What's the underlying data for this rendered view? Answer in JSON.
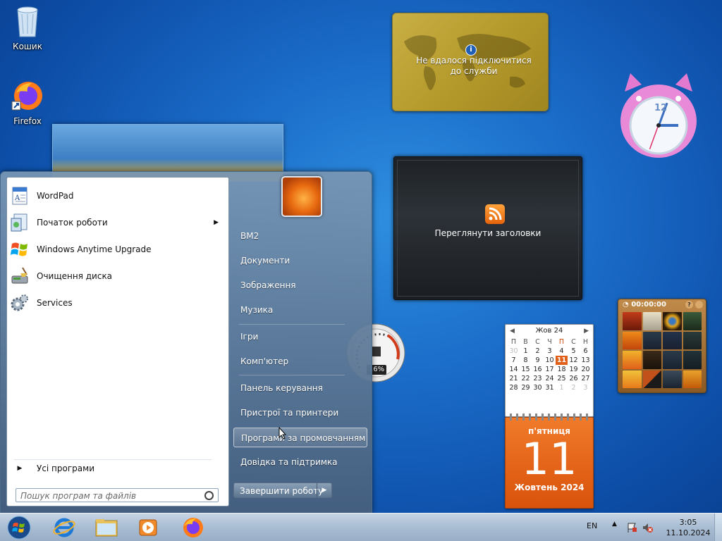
{
  "desktop": {
    "icons": [
      {
        "label": "Кошик",
        "icon": "recycle-bin-icon"
      },
      {
        "label": "Firefox",
        "icon": "firefox-icon"
      }
    ]
  },
  "gadgets": {
    "currency": {
      "message": "Не вдалося підключитися до служби"
    },
    "feeds": {
      "label": "Переглянути заголовки"
    },
    "cpu": {
      "value": "16%"
    },
    "clock": {
      "hour_numeral": "12"
    },
    "calendar": {
      "month_label": "Жов 24",
      "weekdays": [
        "П",
        "В",
        "С",
        "Ч",
        "П",
        "С",
        "Н"
      ],
      "weeks": [
        [
          "30",
          "1",
          "2",
          "3",
          "4",
          "5",
          "6"
        ],
        [
          "7",
          "8",
          "9",
          "10",
          "11",
          "12",
          "13"
        ],
        [
          "14",
          "15",
          "16",
          "17",
          "18",
          "19",
          "20"
        ],
        [
          "21",
          "22",
          "23",
          "24",
          "25",
          "26",
          "27"
        ],
        [
          "28",
          "29",
          "30",
          "31",
          "1",
          "2",
          "3"
        ]
      ],
      "today": "11",
      "weekday_full": "п'ятниця",
      "day_big": "11",
      "month_year": "Жовтень 2024"
    },
    "puzzle": {
      "timer": "00:00:00"
    }
  },
  "start_menu": {
    "programs": [
      {
        "label": "WordPad",
        "icon": "wordpad-icon",
        "submenu": false
      },
      {
        "label": "Початок роботи",
        "icon": "getting-started-icon",
        "submenu": true
      },
      {
        "label": "Windows Anytime Upgrade",
        "icon": "windows-flag-icon",
        "submenu": false
      },
      {
        "label": "Очищення диска",
        "icon": "disk-cleanup-icon",
        "submenu": false
      },
      {
        "label": "Services",
        "icon": "services-gear-icon",
        "submenu": false
      }
    ],
    "all_programs": "Усі програми",
    "search_placeholder": "Пошук програм та файлів",
    "right_items": [
      "ВМ2",
      "Документи",
      "Зображення",
      "Музика",
      "Ігри",
      "Комп'ютер",
      "Панель керування",
      "Пристрої та принтери",
      "Програми за промовчанням",
      "Довідка та підтримка"
    ],
    "highlighted_item": "Програми за промовчанням",
    "shutdown_label": "Завершити роботу"
  },
  "taskbar": {
    "pinned": [
      "start-orb-icon",
      "internet-explorer-icon",
      "windows-explorer-icon",
      "media-player-icon",
      "firefox-icon"
    ],
    "language": "EN",
    "time": "3:05",
    "date": "11.10.2024"
  },
  "colors": {
    "desktop_bg": "#1a6cc8",
    "calendar_orange": "#e0601a",
    "taskbar": "#a8bcd2"
  }
}
